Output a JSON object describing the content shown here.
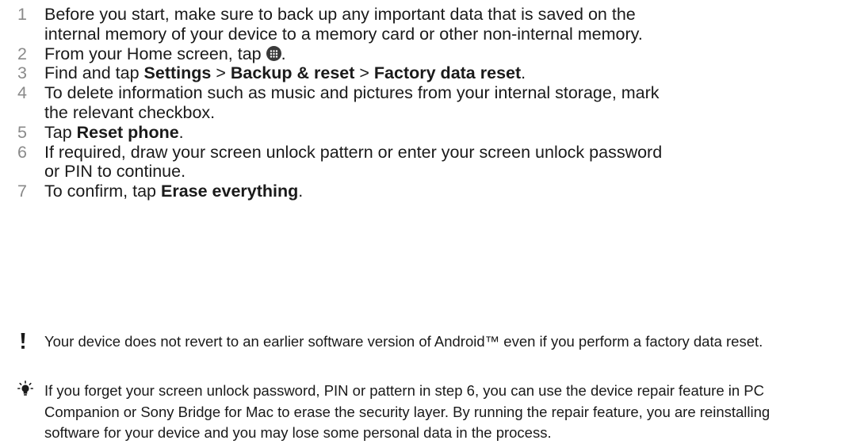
{
  "steps": [
    {
      "num": "1",
      "text": "Before you start, make sure to back up any important data that is saved on the internal memory of your device to a memory card or other non-internal memory."
    },
    {
      "num": "2",
      "text_before": "From your Home screen, tap ",
      "icon": "apps-icon",
      "text_after": "."
    },
    {
      "num": "3",
      "text_before": "Find and tap ",
      "bold1": "Settings",
      "sep1": " > ",
      "bold2": "Backup & reset",
      "sep2": " > ",
      "bold3": "Factory data reset",
      "text_after": "."
    },
    {
      "num": "4",
      "text": "To delete information such as music and pictures from your internal storage, mark the relevant checkbox."
    },
    {
      "num": "5",
      "text_before": "Tap ",
      "bold1": "Reset phone",
      "text_after": "."
    },
    {
      "num": "6",
      "text": "If required, draw your screen unlock pattern or enter your screen unlock password or PIN to continue."
    },
    {
      "num": "7",
      "text_before": "To confirm, tap ",
      "bold1": "Erase everything",
      "text_after": "."
    }
  ],
  "notes": {
    "warning": {
      "icon": "exclamation-icon",
      "text": "Your device does not revert to an earlier software version of Android™ even if you perform a factory data reset."
    },
    "tip": {
      "icon": "lightbulb-icon",
      "text": "If you forget your screen unlock password, PIN or pattern in step 6, you can use the device repair feature in PC Companion or Sony Bridge for Mac to erase the security layer. By running the repair feature, you are reinstalling software for your device and you may lose some personal data in the process."
    }
  }
}
